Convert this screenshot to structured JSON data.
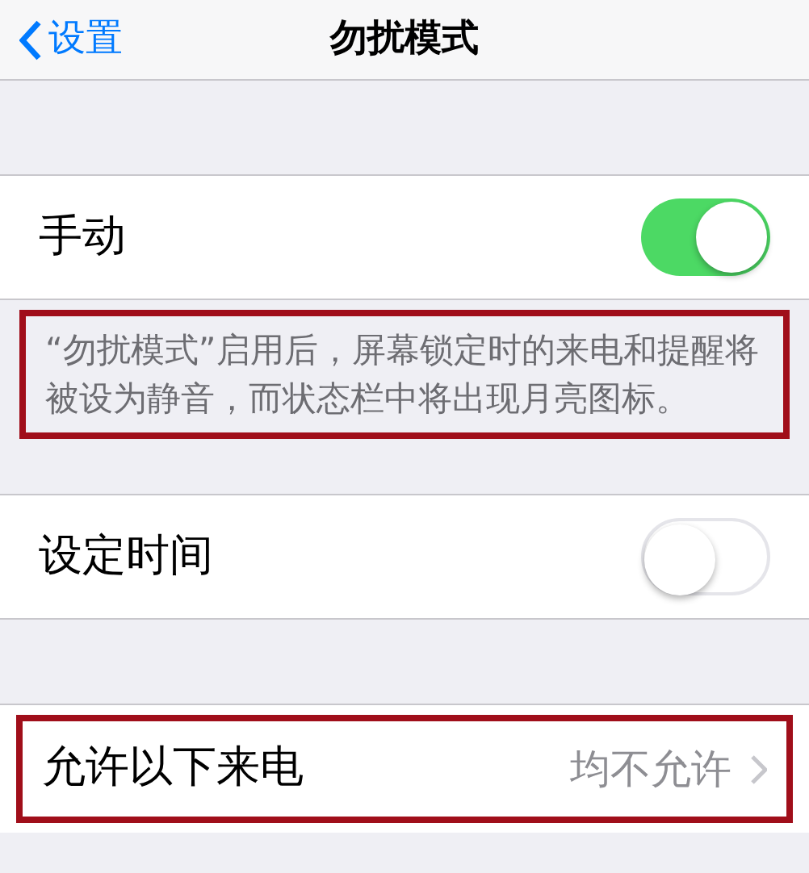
{
  "nav": {
    "back": "设置",
    "title": "勿扰模式"
  },
  "sections": [
    {
      "kind": "toggle",
      "label": "手动",
      "on": true
    },
    {
      "kind": "note",
      "text": "“勿扰模式”启用后，屏幕锁定时的来电和提醒将被设为静音，而状态栏中将出现月亮图标。",
      "highlighted": true
    },
    {
      "kind": "toggle",
      "label": "设定时间",
      "on": false
    },
    {
      "kind": "link",
      "label": "允许以下来电",
      "value": "均不允许",
      "highlighted": true
    }
  ]
}
